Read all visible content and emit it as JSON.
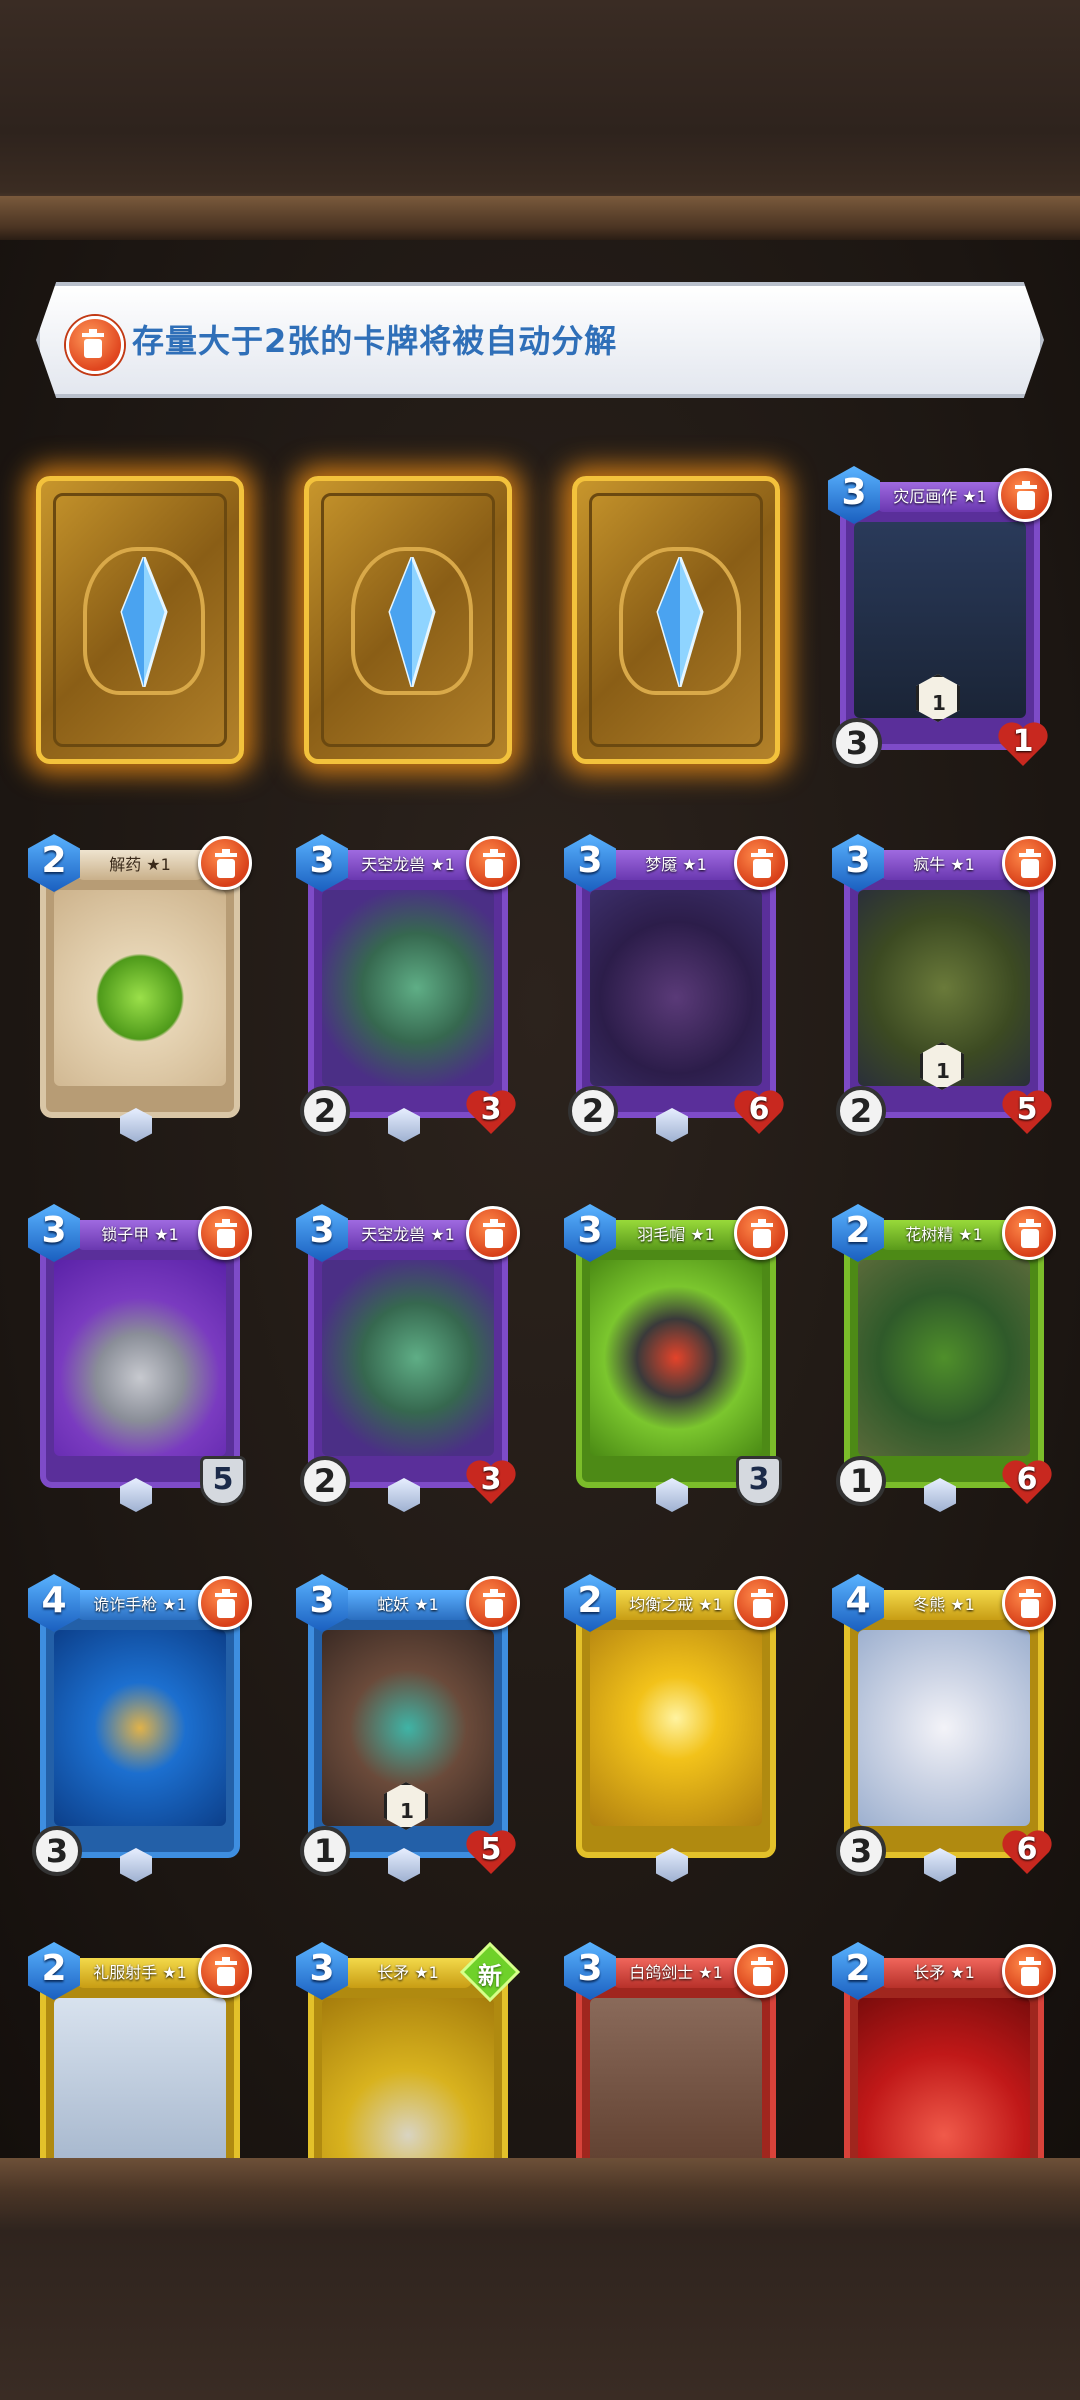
{
  "notice": {
    "text": "存量大于2张的卡牌将被自动分解",
    "icon": "trash-icon"
  },
  "card_backs": [
    {
      "name": "card-back-1"
    },
    {
      "name": "card-back-2"
    },
    {
      "name": "card-back-3"
    }
  ],
  "cards": [
    {
      "id": "c4",
      "title": "灾厄画作 ★1",
      "cost": "3",
      "attack": "3",
      "health": "1",
      "ability": "1",
      "color": "purple"
    },
    {
      "id": "c5",
      "title": "解药 ★1",
      "cost": "2",
      "color": "tan"
    },
    {
      "id": "c6",
      "title": "天空龙兽 ★1",
      "cost": "3",
      "attack": "2",
      "health": "3",
      "color": "purple"
    },
    {
      "id": "c7",
      "title": "梦魇 ★1",
      "cost": "3",
      "attack": "2",
      "health": "6",
      "color": "purple"
    },
    {
      "id": "c8",
      "title": "疯牛 ★1",
      "cost": "3",
      "attack": "2",
      "health": "5",
      "ability": "1",
      "color": "purple"
    },
    {
      "id": "c9",
      "title": "锁子甲 ★1",
      "cost": "3",
      "shield": "5",
      "color": "purple"
    },
    {
      "id": "c10",
      "title": "天空龙兽 ★1",
      "cost": "3",
      "attack": "2",
      "health": "3",
      "color": "purple"
    },
    {
      "id": "c11",
      "title": "羽毛帽 ★1",
      "cost": "3",
      "shield": "3",
      "color": "green"
    },
    {
      "id": "c12",
      "title": "花树精 ★1",
      "cost": "2",
      "attack": "1",
      "health": "6",
      "color": "green"
    },
    {
      "id": "c13",
      "title": "诡诈手枪 ★1",
      "cost": "4",
      "attack": "3",
      "color": "blue"
    },
    {
      "id": "c14",
      "title": "蛇妖 ★1",
      "cost": "3",
      "attack": "1",
      "health": "5",
      "ability": "1",
      "color": "blue"
    },
    {
      "id": "c15",
      "title": "均衡之戒 ★1",
      "cost": "2",
      "color": "gold"
    },
    {
      "id": "c16",
      "title": "冬熊 ★1",
      "cost": "4",
      "attack": "3",
      "health": "6",
      "color": "gold"
    },
    {
      "id": "c17",
      "title": "礼服射手 ★1",
      "cost": "2",
      "color": "gold"
    },
    {
      "id": "c18",
      "title": "长矛 ★1",
      "cost": "3",
      "color": "gold",
      "badge": "新"
    },
    {
      "id": "c19",
      "title": "白鸽剑士 ★1",
      "cost": "3",
      "color": "red"
    },
    {
      "id": "c20",
      "title": "长矛 ★1",
      "cost": "2",
      "color": "red"
    }
  ]
}
